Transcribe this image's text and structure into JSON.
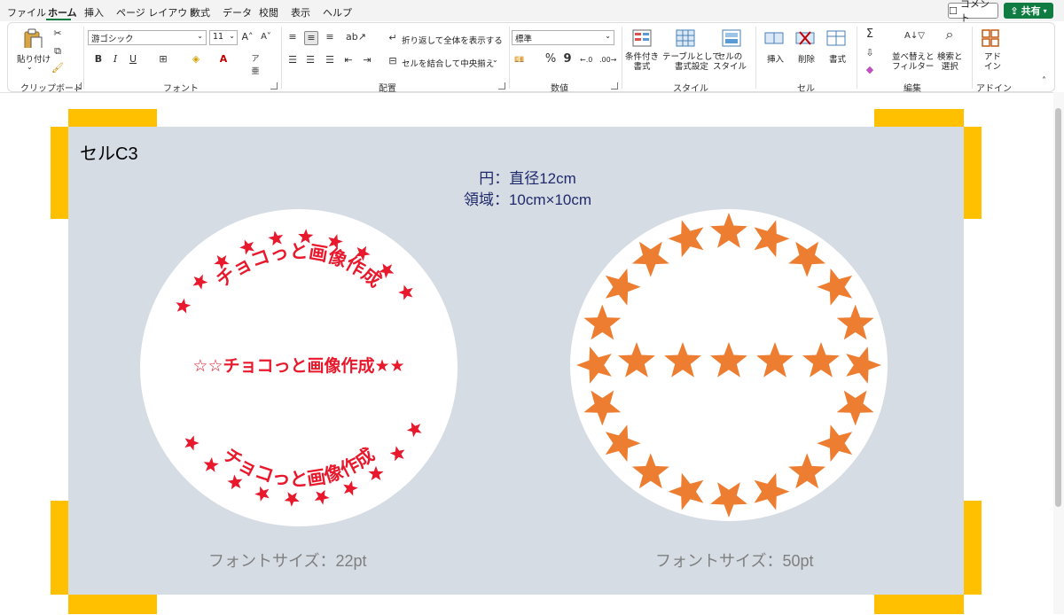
{
  "menu": {
    "tabs": [
      "ファイル",
      "ホーム",
      "挿入",
      "ページ レイアウト",
      "数式",
      "データ",
      "校閲",
      "表示",
      "ヘルプ"
    ],
    "active_tab": "ホーム",
    "comment_label": "コメント",
    "share_label": "共有"
  },
  "ribbon": {
    "clipboard": {
      "paste_label": "貼り付け",
      "group_label": "クリップボード"
    },
    "font": {
      "font_name": "游ゴシック",
      "font_size": "11",
      "bold": "B",
      "italic": "I",
      "underline": "U",
      "group_label": "フォント"
    },
    "alignment": {
      "wrap_text": "折り返して全体を表示する",
      "merge_center": "セルを結合して中央揃え",
      "group_label": "配置"
    },
    "number": {
      "format": "標準",
      "percent": "%",
      "comma": "9",
      "group_label": "数値"
    },
    "styles": {
      "conditional": "条件付き\n書式",
      "table": "テーブルとして\n書式設定",
      "cell_styles": "セルの\nスタイル",
      "group_label": "スタイル"
    },
    "cells": {
      "insert": "挿入",
      "delete": "削除",
      "format": "書式",
      "group_label": "セル"
    },
    "editing": {
      "sort_filter": "並べ替えと\nフィルター",
      "find_select": "検索と\n選択",
      "group_label": "編集"
    },
    "addins": {
      "addin": "アド\nイン",
      "group_label": "アドイン"
    }
  },
  "sheet": {
    "cell_title": "セルC3",
    "info_line1": "円：直径12cm",
    "info_line2": "領域：10cm×10cm",
    "left_caption": "フォントサイズ：22pt",
    "right_caption": "フォントサイズ：50pt",
    "left_text": "チョコっと画像作成",
    "left_middle": "☆☆チョコっと画像作成★★",
    "star_glyph": "★",
    "colors": {
      "red": "#e8192c",
      "orange": "#ed7d31",
      "yellow": "#ffc000",
      "cell_bg": "#d6dce4",
      "info_text": "#1f2a6b",
      "caption": "#7f7f7f"
    }
  }
}
